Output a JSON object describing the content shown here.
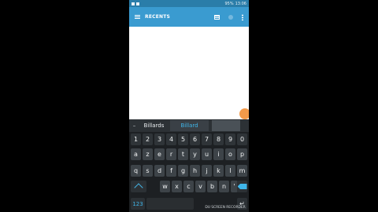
{
  "status_bar": {
    "battery": "95%",
    "time": "13:06"
  },
  "app_bar": {
    "title": "RECENTS"
  },
  "suggestions": {
    "left": "Billards",
    "main": "Billard",
    "right": ""
  },
  "keyboard": {
    "row_numbers": [
      "1",
      "2",
      "3",
      "4",
      "5",
      "6",
      "7",
      "8",
      "9",
      "0"
    ],
    "row_1": [
      "a",
      "z",
      "e",
      "r",
      "t",
      "y",
      "u",
      "i",
      "o",
      "p"
    ],
    "row_2": [
      "q",
      "s",
      "d",
      "f",
      "g",
      "h",
      "j",
      "k",
      "l",
      "m"
    ],
    "row_3": [
      "w",
      "x",
      "c",
      "v",
      "b",
      "n",
      "'"
    ],
    "mode_label": "123",
    "enter_label": "↵"
  },
  "watermark": "DU SCREEN RECORDER",
  "colors": {
    "app_bar": "#3a9bd0",
    "status_bar": "#2a7da9",
    "fab": "#f39a4a",
    "accent": "#3fb6ea"
  }
}
